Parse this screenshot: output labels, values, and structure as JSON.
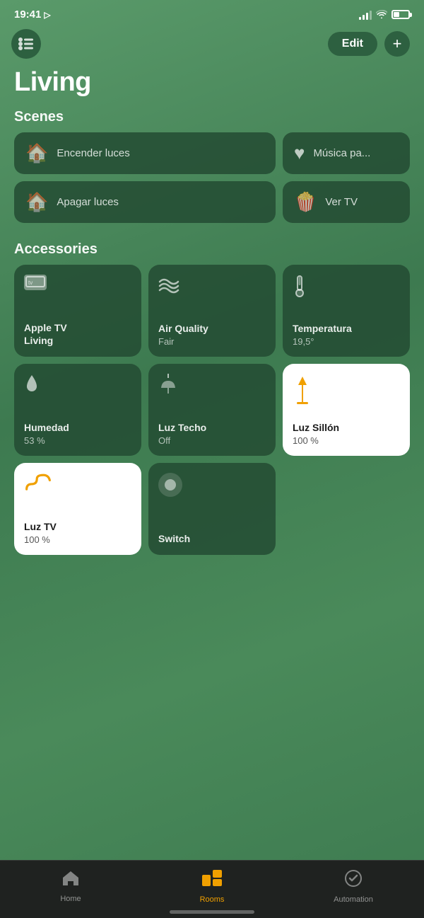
{
  "statusBar": {
    "time": "19:41",
    "locationIcon": "▶"
  },
  "header": {
    "menuLabel": "≡",
    "editLabel": "Edit",
    "addLabel": "+",
    "title": "Living"
  },
  "sections": {
    "scenes": "Scenes",
    "accessories": "Accessories"
  },
  "scenes": [
    {
      "id": "encender",
      "icon": "🏠",
      "label": "Encender luces"
    },
    {
      "id": "musica",
      "icon": "♥",
      "label": "Música pa..."
    },
    {
      "id": "apagar",
      "icon": "🏠",
      "label": "Apagar luces"
    },
    {
      "id": "vertv",
      "icon": "🍿",
      "label": "Ver TV"
    }
  ],
  "accessories": [
    {
      "id": "appletv",
      "type": "appletv",
      "name": "Apple TV\nLiving",
      "status": "",
      "active": false
    },
    {
      "id": "airquality",
      "type": "air",
      "name": "Air Quality",
      "status": "Fair",
      "active": false
    },
    {
      "id": "temperatura",
      "type": "thermometer",
      "name": "Temperatura",
      "status": "19,5°",
      "active": false
    },
    {
      "id": "humedad",
      "type": "drop",
      "name": "Humedad",
      "status": "53 %",
      "active": false
    },
    {
      "id": "luztecho",
      "type": "lamp-ceiling",
      "name": "Luz Techo",
      "status": "Off",
      "active": false
    },
    {
      "id": "luzsillon",
      "type": "lamp-floor",
      "name": "Luz Sillón",
      "status": "100 %",
      "active": true
    },
    {
      "id": "luztv",
      "type": "strip",
      "name": "Luz TV",
      "status": "100 %",
      "active": true
    },
    {
      "id": "switch",
      "type": "switch",
      "name": "Switch",
      "status": "",
      "active": false
    }
  ],
  "nav": {
    "items": [
      {
        "id": "home",
        "icon": "🏠",
        "label": "Home",
        "active": false
      },
      {
        "id": "rooms",
        "icon": "▣",
        "label": "Rooms",
        "active": true
      },
      {
        "id": "automation",
        "icon": "✅",
        "label": "Automation",
        "active": false
      }
    ]
  }
}
